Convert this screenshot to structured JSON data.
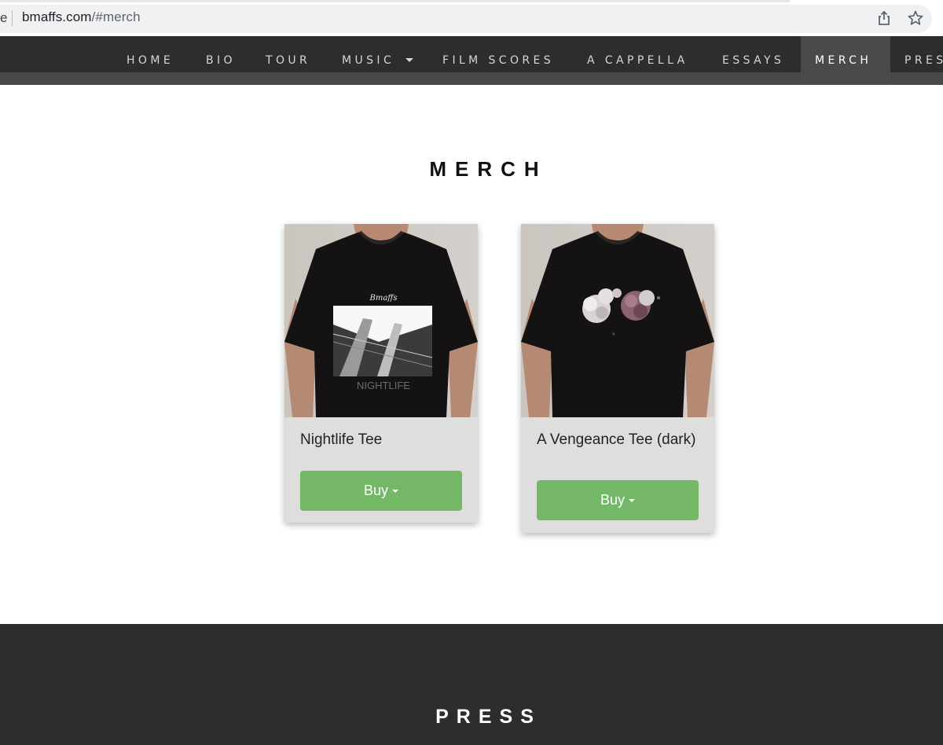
{
  "browser": {
    "url_prefix": "e",
    "url_domain": "bmaffs.com",
    "url_path": "/#merch",
    "share_icon": "share-icon",
    "bookmark_icon": "star-icon"
  },
  "nav": {
    "items": [
      {
        "label": "HOME"
      },
      {
        "label": "BIO"
      },
      {
        "label": "TOUR"
      },
      {
        "label": "MUSIC"
      },
      {
        "label": "FILM SCORES"
      },
      {
        "label": "A CAPPELLA"
      },
      {
        "label": "ESSAYS"
      },
      {
        "label": "MERCH"
      },
      {
        "label": "PRES"
      }
    ],
    "active": "MERCH"
  },
  "merch": {
    "title": "MERCH",
    "products": [
      {
        "name": "Nightlife Tee",
        "buy_label": "Buy",
        "shirt_print_brand": "Bmaffs",
        "shirt_print_title": "NIGHTLIFE"
      },
      {
        "name": "A Vengeance Tee (dark)",
        "buy_label": "Buy"
      }
    ]
  },
  "press": {
    "title": "PRESS"
  },
  "colors": {
    "nav_bg": "#2d2d2d",
    "nav_active": "#4a4a4a",
    "card_bg": "#dedede",
    "buy_button": "#74b766"
  }
}
